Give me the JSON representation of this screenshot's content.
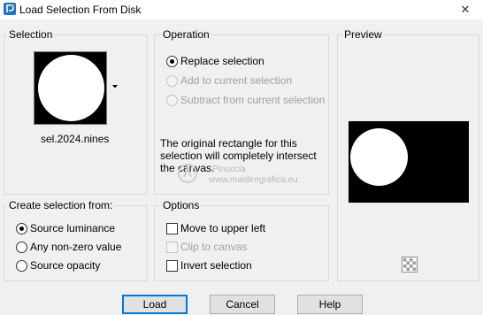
{
  "window": {
    "title": "Load Selection From Disk",
    "close_glyph": "✕",
    "app_icon": "psp-app-icon"
  },
  "selection": {
    "group_label": "Selection",
    "file_name": "sel.2024.nines",
    "dropdown_icon": "chevron-down-icon"
  },
  "operation": {
    "group_label": "Operation",
    "options": [
      {
        "label": "Replace selection",
        "checked": true,
        "enabled": true
      },
      {
        "label": "Add to current selection",
        "checked": false,
        "enabled": false
      },
      {
        "label": "Subtract from current selection",
        "checked": false,
        "enabled": false
      }
    ],
    "message": "The original rectangle for this selection will completely intersect the canvas."
  },
  "preview": {
    "group_label": "Preview",
    "transparency_icon": "checkerboard-icon"
  },
  "create_from": {
    "group_label": "Create selection from:",
    "options": [
      {
        "label": "Source luminance",
        "checked": true
      },
      {
        "label": "Any non-zero value",
        "checked": false
      },
      {
        "label": "Source opacity",
        "checked": false
      }
    ]
  },
  "options": {
    "group_label": "Options",
    "items": [
      {
        "label": "Move to upper left",
        "checked": false,
        "enabled": true
      },
      {
        "label": "Clip to canvas",
        "checked": false,
        "enabled": false
      },
      {
        "label": "Invert selection",
        "checked": false,
        "enabled": true
      }
    ]
  },
  "buttons": {
    "load": "Load",
    "cancel": "Cancel",
    "help": "Help"
  },
  "watermark": {
    "line1": "Pinuccia",
    "line2": "www.maidiregrafica.eu"
  }
}
